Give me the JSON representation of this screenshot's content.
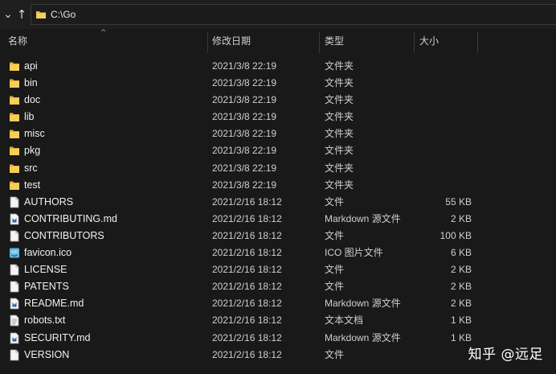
{
  "address": {
    "path": "C:\\Go"
  },
  "columns": {
    "name": "名称",
    "date": "修改日期",
    "type": "类型",
    "size": "大小"
  },
  "files": [
    {
      "name": "api",
      "date": "2021/3/8 22:19",
      "type": "文件夹",
      "size": "",
      "icon": "folder-icon"
    },
    {
      "name": "bin",
      "date": "2021/3/8 22:19",
      "type": "文件夹",
      "size": "",
      "icon": "folder-icon"
    },
    {
      "name": "doc",
      "date": "2021/3/8 22:19",
      "type": "文件夹",
      "size": "",
      "icon": "folder-icon"
    },
    {
      "name": "lib",
      "date": "2021/3/8 22:19",
      "type": "文件夹",
      "size": "",
      "icon": "folder-icon"
    },
    {
      "name": "misc",
      "date": "2021/3/8 22:19",
      "type": "文件夹",
      "size": "",
      "icon": "folder-icon"
    },
    {
      "name": "pkg",
      "date": "2021/3/8 22:19",
      "type": "文件夹",
      "size": "",
      "icon": "folder-icon"
    },
    {
      "name": "src",
      "date": "2021/3/8 22:19",
      "type": "文件夹",
      "size": "",
      "icon": "folder-icon"
    },
    {
      "name": "test",
      "date": "2021/3/8 22:19",
      "type": "文件夹",
      "size": "",
      "icon": "folder-icon"
    },
    {
      "name": "AUTHORS",
      "date": "2021/2/16 18:12",
      "type": "文件",
      "size": "55 KB",
      "icon": "file-icon"
    },
    {
      "name": "CONTRIBUTING.md",
      "date": "2021/2/16 18:12",
      "type": "Markdown 源文件",
      "size": "2 KB",
      "icon": "markdown-file-icon"
    },
    {
      "name": "CONTRIBUTORS",
      "date": "2021/2/16 18:12",
      "type": "文件",
      "size": "100 KB",
      "icon": "file-icon"
    },
    {
      "name": "favicon.ico",
      "date": "2021/2/16 18:12",
      "type": "ICO 图片文件",
      "size": "6 KB",
      "icon": "image-file-icon"
    },
    {
      "name": "LICENSE",
      "date": "2021/2/16 18:12",
      "type": "文件",
      "size": "2 KB",
      "icon": "file-icon"
    },
    {
      "name": "PATENTS",
      "date": "2021/2/16 18:12",
      "type": "文件",
      "size": "2 KB",
      "icon": "file-icon"
    },
    {
      "name": "README.md",
      "date": "2021/2/16 18:12",
      "type": "Markdown 源文件",
      "size": "2 KB",
      "icon": "markdown-file-icon"
    },
    {
      "name": "robots.txt",
      "date": "2021/2/16 18:12",
      "type": "文本文档",
      "size": "1 KB",
      "icon": "text-file-icon"
    },
    {
      "name": "SECURITY.md",
      "date": "2021/2/16 18:12",
      "type": "Markdown 源文件",
      "size": "1 KB",
      "icon": "markdown-file-icon"
    },
    {
      "name": "VERSION",
      "date": "2021/2/16 18:12",
      "type": "文件",
      "size": "",
      "icon": "file-icon"
    }
  ],
  "watermark": "知乎 @远足",
  "colors": {
    "background": "#191919",
    "folder": "#f1c24e",
    "text": "#f0f0f0"
  }
}
